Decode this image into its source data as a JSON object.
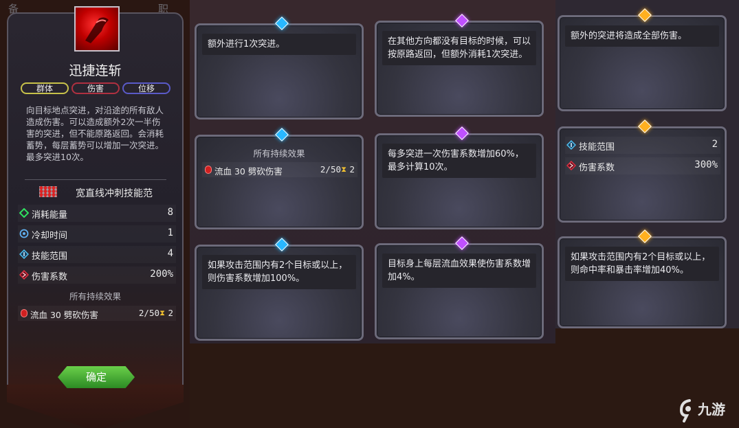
{
  "background": {
    "top_left_hint": "备",
    "top_mid_hint": "职"
  },
  "skill": {
    "title": "迅捷连斩",
    "tags": [
      "群体",
      "伤害",
      "位移"
    ],
    "description": "向目标地点突进，对沿途的所有敌人造成伤害。可以造成额外2次一半伤害的突进，但不能原路返回。会消耗蓄势，每层蓄势可以增加一次突进。最多突进10次。",
    "range_shape": "宽直线冲刺技能范",
    "stats": [
      {
        "icon": "energy-icon",
        "label": "消耗能量",
        "value": "8"
      },
      {
        "icon": "cooldown-icon",
        "label": "冷却时间",
        "value": "1"
      },
      {
        "icon": "range-icon",
        "label": "技能范围",
        "value": "4"
      },
      {
        "icon": "damage-icon",
        "label": "伤害系数",
        "value": "200%"
      }
    ],
    "effects_header": "所有持续效果",
    "effect": {
      "name": "流血 30 劈砍伤害",
      "count": "2/50",
      "duration": "2"
    },
    "confirm_label": "确定"
  },
  "cards": [
    {
      "gem": "blue",
      "text": "额外进行1次突进。"
    },
    {
      "gem": "purple",
      "text": "在其他方向都没有目标的时候，可以按原路返回，但额外消耗1次突进。"
    },
    {
      "gem": "gold",
      "text": "额外的突进将造成全部伤害。"
    },
    {
      "gem": "blue",
      "header": "所有持续效果",
      "effect": {
        "name": "流血 30 劈砍伤害",
        "count": "2/50",
        "duration": "2"
      }
    },
    {
      "gem": "purple",
      "text": "每多突进一次伤害系数增加60%，最多计算10次。"
    },
    {
      "gem": "gold",
      "stats": [
        {
          "icon": "range-icon",
          "label": "技能范围",
          "value": "2"
        },
        {
          "icon": "damage-icon",
          "label": "伤害系数",
          "value": "300%"
        }
      ]
    },
    {
      "gem": "blue",
      "text": "如果攻击范围内有2个目标或以上，则伤害系数增加100%。"
    },
    {
      "gem": "purple",
      "text": "目标身上每层流血效果使伤害系数增加4%。"
    },
    {
      "gem": "gold",
      "text": "如果攻击范围内有2个目标或以上，则命中率和暴击率增加40%。"
    }
  ],
  "watermark": "九游"
}
